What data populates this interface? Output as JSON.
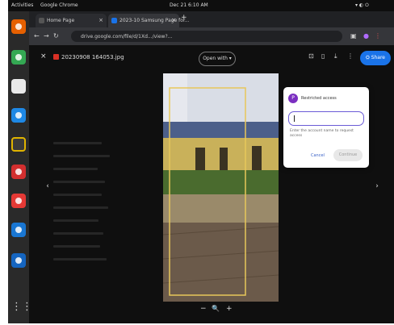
{
  "os": {
    "activities": "Activities",
    "app_menu": "Google Chrome",
    "clock": "Dec 21 6:10 AM"
  },
  "browser": {
    "tabs": [
      {
        "label": "Home Page"
      },
      {
        "label": "2023-10 Samsung Page for..."
      }
    ],
    "url": "drive.google.com/file/d/1Xd.../view?..."
  },
  "viewer": {
    "file_name": "20230908 164053.jpg",
    "open_with": "Open with",
    "share_label": "Share",
    "zoom_out": "−",
    "zoom_in": "+"
  },
  "dialog": {
    "avatar_letter": "P",
    "title": "Restricted access",
    "hint": "Enter the account name to request access",
    "cancel": "Cancel",
    "continue": "Continue"
  },
  "colors": {
    "accent": "#1a73e8",
    "dialog_accent": "#6b5bd6",
    "badge": "#7b2fc1"
  }
}
